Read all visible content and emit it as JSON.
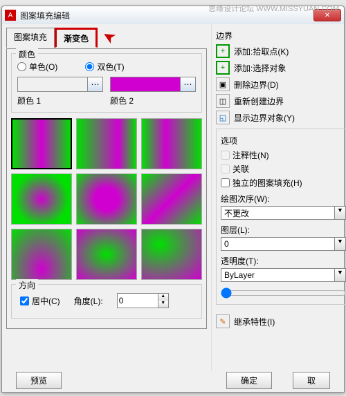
{
  "watermark": "思缘设计论坛 WWW.MISSYUAN.COM",
  "window": {
    "title": "图案填充编辑"
  },
  "tabs": {
    "pattern": "图案填充",
    "gradient": "渐变色"
  },
  "color_group": {
    "title": "颜色",
    "one": "单色(O)",
    "two": "双色(T)",
    "color1_label": "颜色 1",
    "color2_label": "颜色 2",
    "color1": "#00e000",
    "color2": "#d000d0"
  },
  "direction": {
    "title": "方向",
    "centered": "居中(C)",
    "angle_label": "角度(L):",
    "angle_value": "0"
  },
  "boundary": {
    "title": "边界",
    "add_pick": "添加:拾取点(K)",
    "add_select": "添加:选择对象",
    "remove": "删除边界(D)",
    "recreate": "重新创建边界",
    "show": "显示边界对象(Y)"
  },
  "options": {
    "title": "选项",
    "annotative": "注释性(N)",
    "associative": "关联",
    "independent": "独立的图案填充(H)"
  },
  "draw_order": {
    "label": "绘图次序(W):",
    "value": "不更改"
  },
  "layer": {
    "label": "图层(L):",
    "value": "0"
  },
  "transparency": {
    "label": "透明度(T):",
    "value": "ByLayer"
  },
  "inherit": "继承特性(I)",
  "footer": {
    "preview": "预览",
    "ok": "确定",
    "cancel": "取"
  }
}
